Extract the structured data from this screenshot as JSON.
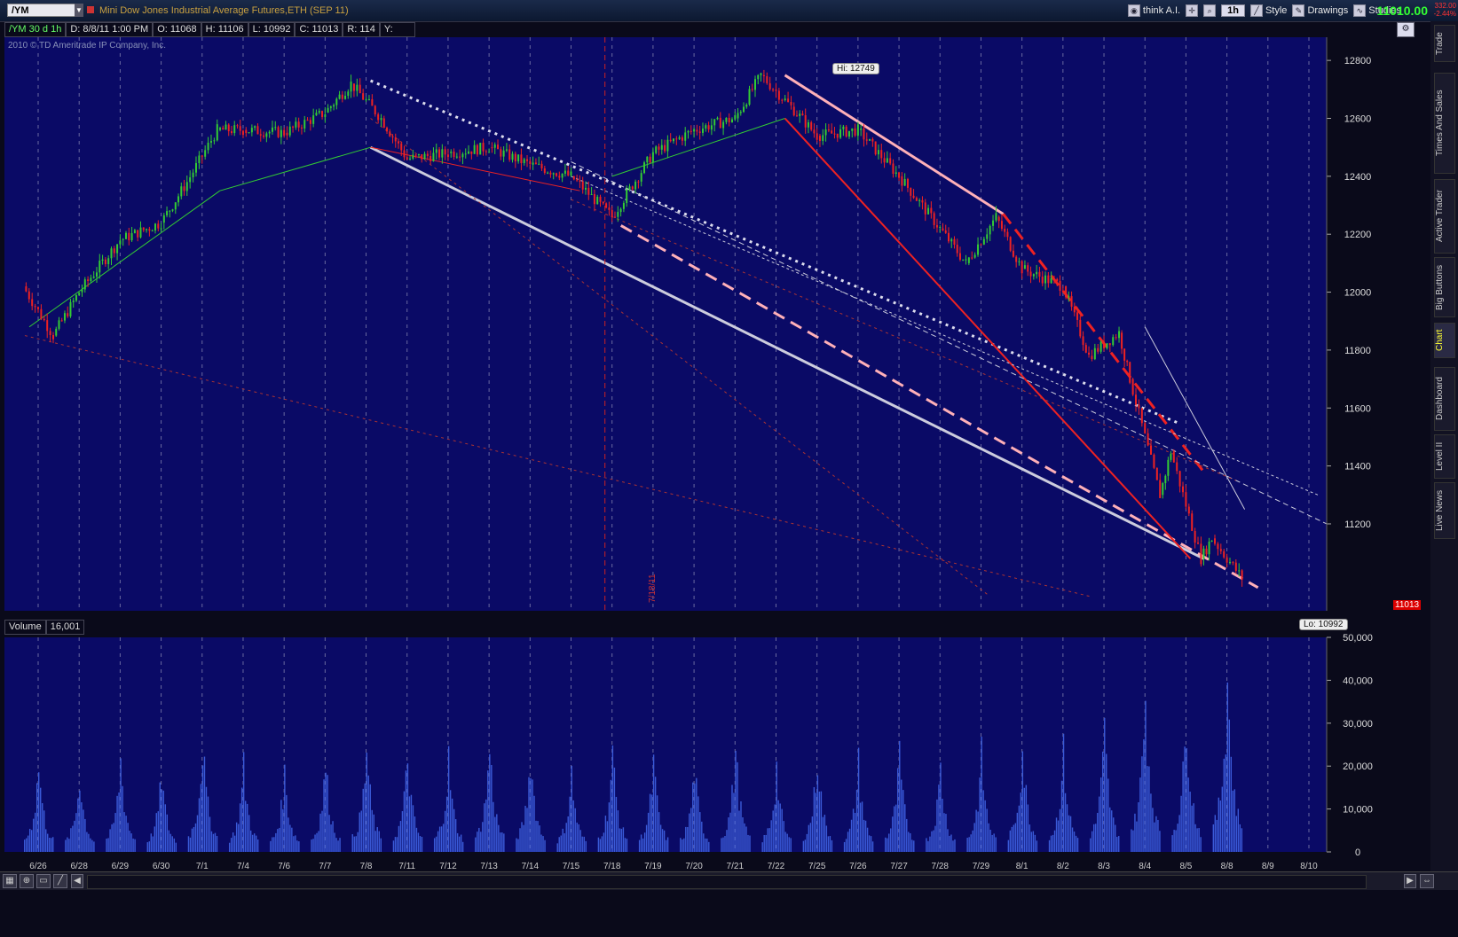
{
  "toolbar": {
    "symbol": "/YM",
    "instrument_title": "Mini Dow Jones Industrial Average Futures,ETH (SEP 11)",
    "buttons": [
      "think A.I.",
      "1h",
      "Style",
      "Drawings",
      "Studies"
    ],
    "last_price": "11010.00",
    "change_top": "332.00",
    "change_bottom": "-2.44%"
  },
  "info_bar": {
    "symbol_period": "/YM 30 d 1h",
    "date": "D: 8/8/11 1:00 PM",
    "open": "O: 11068",
    "high": "H: 11106",
    "low": "L: 10992",
    "close": "C: 11013",
    "range": "R: 114",
    "y": "Y:"
  },
  "copyright": "2010 © TD Ameritrade IP Company, Inc.",
  "annotations": {
    "hi": "Hi: 12749",
    "lo": "Lo: 10992",
    "current_price_tag": "11013",
    "vertical_date": "7/18/11"
  },
  "volume_panel": {
    "label": "Volume",
    "value": "16,001"
  },
  "side_tabs": [
    "Trade",
    "Times And Sales",
    "Active Trader",
    "Big Buttons",
    "Chart",
    "Dashboard",
    "Level II",
    "Live News"
  ],
  "colors": {
    "background": "#0a0a66",
    "candle_up": "#33cc33",
    "candle_down": "#ee2222",
    "grid": "#6a6aa0",
    "volume": "#3a5ad8",
    "trend_pink": "#ffb0b8",
    "trend_red": "#ee2222",
    "trend_green": "#33cc33"
  },
  "chart_data": [
    {
      "type": "candlestick",
      "title": "Mini Dow Jones Industrial Average Futures,ETH (SEP 11)",
      "x_labels": [
        "6/26",
        "6/28",
        "6/29",
        "6/30",
        "7/1",
        "7/4",
        "7/6",
        "7/7",
        "7/8",
        "7/11",
        "7/12",
        "7/13",
        "7/14",
        "7/15",
        "7/18",
        "7/19",
        "7/20",
        "7/21",
        "7/22",
        "7/25",
        "7/26",
        "7/27",
        "7/28",
        "7/29",
        "8/1",
        "8/2",
        "8/3",
        "8/4",
        "8/5",
        "8/8",
        "8/9",
        "8/10"
      ],
      "y_ticks": [
        12800,
        12600,
        12400,
        12200,
        12000,
        11800,
        11600,
        11400,
        11200
      ],
      "ylim": [
        10900,
        12880
      ],
      "close_path": [
        {
          "x": "6/26",
          "y": 12020
        },
        {
          "x": "6/26",
          "y": 11850
        },
        {
          "x": "6/28",
          "y": 12000
        },
        {
          "x": "6/29",
          "y": 12180
        },
        {
          "x": "6/30",
          "y": 12240
        },
        {
          "x": "7/1",
          "y": 12380
        },
        {
          "x": "7/1",
          "y": 12560
        },
        {
          "x": "7/4",
          "y": 12560
        },
        {
          "x": "7/6",
          "y": 12550
        },
        {
          "x": "7/7",
          "y": 12620
        },
        {
          "x": "7/8",
          "y": 12720
        },
        {
          "x": "7/8",
          "y": 12600
        },
        {
          "x": "7/11",
          "y": 12460
        },
        {
          "x": "7/12",
          "y": 12480
        },
        {
          "x": "7/13",
          "y": 12500
        },
        {
          "x": "7/14",
          "y": 12440
        },
        {
          "x": "7/15",
          "y": 12400
        },
        {
          "x": "7/18",
          "y": 12260
        },
        {
          "x": "7/19",
          "y": 12480
        },
        {
          "x": "7/20",
          "y": 12560
        },
        {
          "x": "7/21",
          "y": 12600
        },
        {
          "x": "7/22",
          "y": 12749
        },
        {
          "x": "7/22",
          "y": 12640
        },
        {
          "x": "7/25",
          "y": 12540
        },
        {
          "x": "7/26",
          "y": 12560
        },
        {
          "x": "7/27",
          "y": 12400
        },
        {
          "x": "7/28",
          "y": 12220
        },
        {
          "x": "7/29",
          "y": 12100
        },
        {
          "x": "7/29",
          "y": 12260
        },
        {
          "x": "8/1",
          "y": 12080
        },
        {
          "x": "8/2",
          "y": 12020
        },
        {
          "x": "8/3",
          "y": 11780
        },
        {
          "x": "8/3",
          "y": 11860
        },
        {
          "x": "8/4",
          "y": 11700
        },
        {
          "x": "8/4",
          "y": 11300
        },
        {
          "x": "8/5",
          "y": 11450
        },
        {
          "x": "8/5",
          "y": 11080
        },
        {
          "x": "8/8",
          "y": 11150
        },
        {
          "x": "8/8",
          "y": 11013
        }
      ],
      "annotations": [
        "Hi: 12749",
        "Lo: 10992"
      ]
    },
    {
      "type": "bar",
      "title": "Volume",
      "y_ticks": [
        50000,
        40000,
        30000,
        20000,
        10000,
        0
      ],
      "ylim": [
        0,
        50000
      ],
      "day_peaks": [
        {
          "x": "6/26",
          "y": 25000
        },
        {
          "x": "6/28",
          "y": 22000
        },
        {
          "x": "6/29",
          "y": 26000
        },
        {
          "x": "6/30",
          "y": 22000
        },
        {
          "x": "7/1",
          "y": 31000
        },
        {
          "x": "7/4",
          "y": 24000
        },
        {
          "x": "7/6",
          "y": 22000
        },
        {
          "x": "7/7",
          "y": 25000
        },
        {
          "x": "7/8",
          "y": 29000
        },
        {
          "x": "7/11",
          "y": 27000
        },
        {
          "x": "7/12",
          "y": 26000
        },
        {
          "x": "7/13",
          "y": 30000
        },
        {
          "x": "7/14",
          "y": 28000
        },
        {
          "x": "7/15",
          "y": 22000
        },
        {
          "x": "7/18",
          "y": 28000
        },
        {
          "x": "7/19",
          "y": 25000
        },
        {
          "x": "7/20",
          "y": 24000
        },
        {
          "x": "7/21",
          "y": 29000
        },
        {
          "x": "7/22",
          "y": 24000
        },
        {
          "x": "7/25",
          "y": 28000
        },
        {
          "x": "7/26",
          "y": 25000
        },
        {
          "x": "7/27",
          "y": 27000
        },
        {
          "x": "7/28",
          "y": 24000
        },
        {
          "x": "7/29",
          "y": 27000
        },
        {
          "x": "8/1",
          "y": 30000
        },
        {
          "x": "8/2",
          "y": 28000
        },
        {
          "x": "8/3",
          "y": 34000
        },
        {
          "x": "8/4",
          "y": 45000
        },
        {
          "x": "8/5",
          "y": 39000
        },
        {
          "x": "8/8",
          "y": 51000
        }
      ]
    }
  ]
}
